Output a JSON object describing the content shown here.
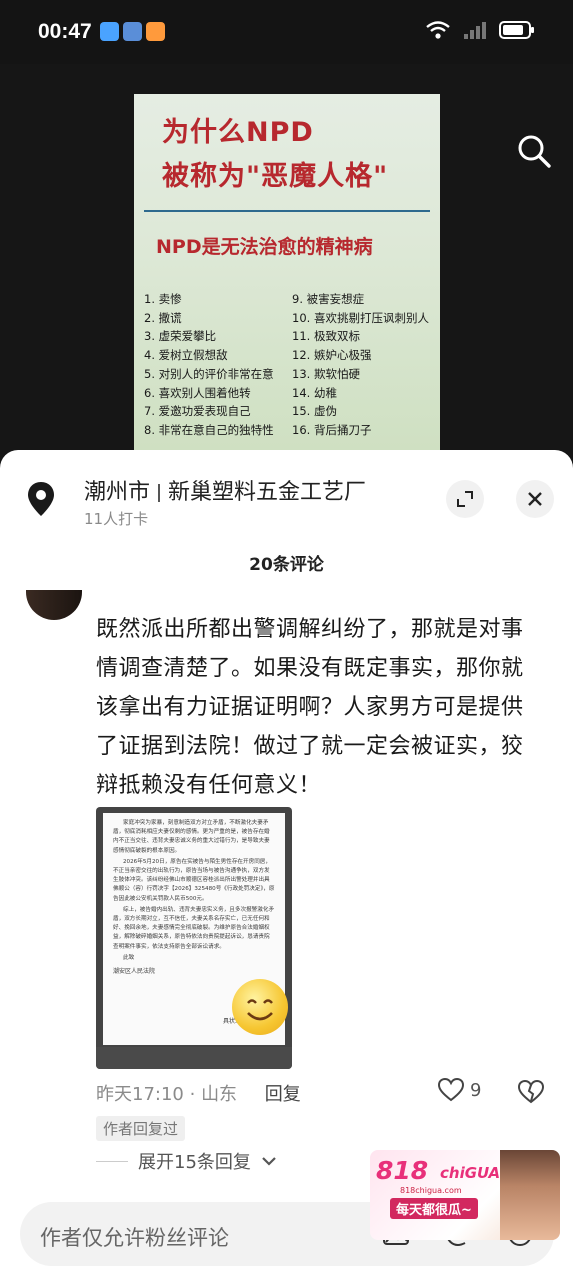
{
  "status_bar": {
    "time": "00:47"
  },
  "poster": {
    "title_line1": "为什么NPD",
    "title_line2": "被称为\"恶魔人格\"",
    "subtitle": "NPD是无法治愈的精神病",
    "list_left": [
      "1. 卖惨",
      "2. 撒谎",
      "3. 虚荣爱攀比",
      "4. 爱树立假想敌",
      "5. 对别人的评价非常在意",
      "6. 喜欢别人围着他转",
      "7. 爱邀功爱表现自己",
      "8. 非常在意自己的独特性"
    ],
    "list_right": [
      "9. 被害妄想症",
      "10. 喜欢挑剔打压讽刺别人",
      "11. 极致双标",
      "12. 嫉妒心极强",
      "13. 欺软怕硬",
      "14. 幼稚",
      "15. 虚伪",
      "16. 背后捅刀子"
    ]
  },
  "location": {
    "city": "潮州市",
    "place": "新巢塑料五金工艺厂",
    "checkins": "11人打卡"
  },
  "comments_header": "20条评论",
  "comment": {
    "text": "既然派出所都出警调解纠纷了，那就是对事情调查清楚了。如果没有既定事实，那你就该拿出有力证据证明啊？人家男方可是提供了证据到法院！做过了就一定会被证实，狡辩抵赖没有任何意义！",
    "time": "昨天17:10",
    "region": "山东",
    "reply_label": "回复",
    "likes": "9",
    "author_tag": "作者回复过",
    "expand_label": "展开15条回复"
  },
  "doc_image": {
    "para1": "家庭冲突为家暴，刻意制造双方对立矛盾，不断激化夫妻矛盾，彻底消耗相应夫妻仅剩的感情。更为严重的是，被告存在婚内不正当交往、违背夫妻忠诚义务的重大过错行为，是导致夫妻感情彻底破裂的根本原因。",
    "para2": "2026年5月20日，原告在实被告与陌生男性存在开房同居，不正当亲密交往的出轨行为，原告当场与被告沟通争执，双方发生肢体冲突。该纠纷经佛山市顺德区容桂派出所出警处理并出具佛顺公（容）行罚决字【2026】325480号《行政处罚决定》，原告因此被公安机关罚款人民币500元。",
    "para3": "综上，被告婚内出轨、违背夫妻忠实义务，且多次报警激化矛盾，双方长期对立，互不信任，夫妻关系名存实亡，已无任何和好、挽回余地，夫妻感情完全彻底破裂。为维护原告合法婚姻权益，解除破碎婚姻关系，原告特依法向贵院提起诉讼，恳请贵院查明案件事实，依法支持原告全部诉讼请求。",
    "closing": "此致",
    "court": "潮安区人民法院",
    "signer": "具状人"
  },
  "input_bar": {
    "placeholder": "作者仅允许粉丝评论"
  },
  "ad": {
    "brand": "818",
    "brand2": "chiGUA",
    "url": "818chigua.com",
    "slogan": "每天都很瓜~"
  }
}
